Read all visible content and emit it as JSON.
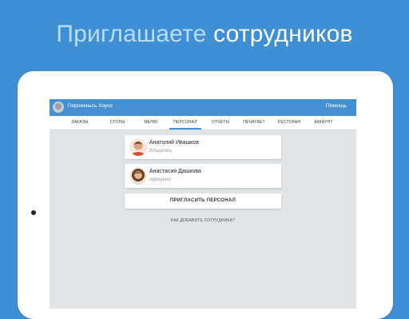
{
  "promo": {
    "title_light": "Приглашаете",
    "title_bold": "сотрудников"
  },
  "app": {
    "restaurant_name": "Пирожкиьсь Хоусе",
    "help_label": "Помощь",
    "tabs": [
      {
        "label": "ЗАКАЗЫ",
        "active": false
      },
      {
        "label": "СТОЛЫ",
        "active": false
      },
      {
        "label": "МЕНЮ",
        "active": false
      },
      {
        "label": "ПЕРСОНАЛ",
        "active": true
      },
      {
        "label": "ОТЧЁТЫ",
        "active": false
      },
      {
        "label": "ПЕЧАТАЕТ",
        "active": false
      },
      {
        "label": "РЕСТОРАН",
        "active": false
      },
      {
        "label": "АККАУНТ",
        "active": false
      }
    ],
    "staff": [
      {
        "name": "Анатолий Ивашков",
        "role": "Владелец"
      },
      {
        "name": "Анастасия Дашкова",
        "role": "официант"
      }
    ],
    "invite_label": "ПРИГЛАСИТЬ ПЕРСОНАЛ",
    "how_to_label": "КАК ДОБАВИТЬ СОТРУДНИКА?"
  },
  "colors": {
    "background": "#3f8fd5",
    "app_bar": "#4590d2",
    "screen_bg": "#dfe4e7"
  }
}
